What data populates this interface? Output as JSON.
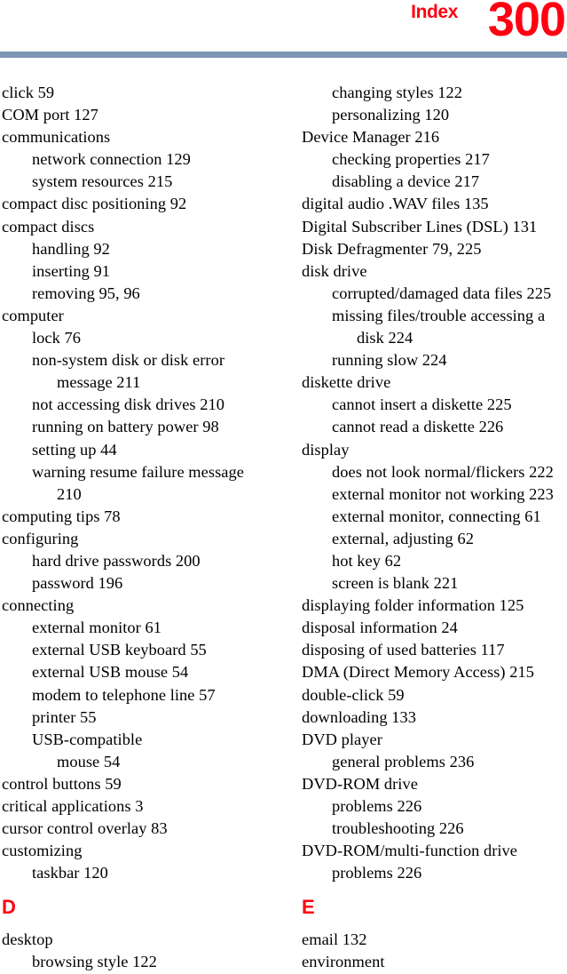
{
  "header": {
    "section_label": "Index",
    "page_number": "300",
    "label_color": "#ff0012",
    "rule_color": "#7e96b4"
  },
  "columns": [
    {
      "name": "left-column",
      "blocks": [
        {
          "type": "entries",
          "entries": [
            {
              "text": "click 59",
              "level": 0
            },
            {
              "text": "COM port 127",
              "level": 0
            },
            {
              "text": "communications",
              "level": 0
            },
            {
              "text": "network connection 129",
              "level": 1
            },
            {
              "text": "system resources 215",
              "level": 1
            },
            {
              "text": "compact disc positioning 92",
              "level": 0
            },
            {
              "text": "compact discs",
              "level": 0
            },
            {
              "text": "handling 92",
              "level": 1
            },
            {
              "text": "inserting 91",
              "level": 1
            },
            {
              "text": "removing 95, 96",
              "level": 1
            },
            {
              "text": "computer",
              "level": 0
            },
            {
              "text": "lock 76",
              "level": 1
            },
            {
              "text": "non-system disk or disk error",
              "level": 1
            },
            {
              "text": "message 211",
              "level": 2
            },
            {
              "text": "not accessing disk drives 210",
              "level": 1
            },
            {
              "text": "running on battery power 98",
              "level": 1
            },
            {
              "text": "setting up 44",
              "level": 1
            },
            {
              "text": "warning resume failure message",
              "level": 1
            },
            {
              "text": "210",
              "level": 2
            },
            {
              "text": "computing tips 78",
              "level": 0
            },
            {
              "text": "configuring",
              "level": 0
            },
            {
              "text": "hard drive passwords 200",
              "level": 1
            },
            {
              "text": "password 196",
              "level": 1
            },
            {
              "text": "connecting",
              "level": 0
            },
            {
              "text": "external monitor 61",
              "level": 1
            },
            {
              "text": "external USB keyboard 55",
              "level": 1
            },
            {
              "text": "external USB mouse 54",
              "level": 1
            },
            {
              "text": "modem to telephone line 57",
              "level": 1
            },
            {
              "text": "printer 55",
              "level": 1
            },
            {
              "text": "USB-compatible",
              "level": 1
            },
            {
              "text": "mouse 54",
              "level": 2
            },
            {
              "text": "control buttons 59",
              "level": 0
            },
            {
              "text": "critical applications 3",
              "level": 0
            },
            {
              "text": "cursor control overlay 83",
              "level": 0
            },
            {
              "text": "customizing",
              "level": 0
            },
            {
              "text": "taskbar 120",
              "level": 1
            }
          ]
        },
        {
          "type": "letter",
          "letter": "D"
        },
        {
          "type": "entries",
          "entries": [
            {
              "text": "desktop",
              "level": 0
            },
            {
              "text": "browsing style 122",
              "level": 1
            }
          ]
        }
      ]
    },
    {
      "name": "right-column",
      "blocks": [
        {
          "type": "entries",
          "entries": [
            {
              "text": "changing styles 122",
              "level": 1
            },
            {
              "text": "personalizing 120",
              "level": 1
            },
            {
              "text": "Device Manager 216",
              "level": 0
            },
            {
              "text": "checking properties 217",
              "level": 1
            },
            {
              "text": "disabling a device 217",
              "level": 1
            },
            {
              "text": "digital audio .WAV files 135",
              "level": 0
            },
            {
              "text": "Digital Subscriber Lines (DSL) 131",
              "level": 0
            },
            {
              "text": "Disk Defragmenter 79, 225",
              "level": 0
            },
            {
              "text": "disk drive",
              "level": 0
            },
            {
              "text": "corrupted/damaged data files 225",
              "level": 1
            },
            {
              "text": "missing files/trouble accessing a",
              "level": 1
            },
            {
              "text": "disk 224",
              "level": 2
            },
            {
              "text": "running slow 224",
              "level": 1
            },
            {
              "text": "diskette drive",
              "level": 0
            },
            {
              "text": "cannot insert a diskette 225",
              "level": 1
            },
            {
              "text": "cannot read a diskette 226",
              "level": 1
            },
            {
              "text": "display",
              "level": 0
            },
            {
              "text": "does not look normal/flickers 222",
              "level": 1
            },
            {
              "text": "external monitor not working 223",
              "level": 1
            },
            {
              "text": "external monitor, connecting 61",
              "level": 1
            },
            {
              "text": "external, adjusting 62",
              "level": 1
            },
            {
              "text": "hot key 62",
              "level": 1
            },
            {
              "text": "screen is blank 221",
              "level": 1
            },
            {
              "text": "displaying folder information 125",
              "level": 0
            },
            {
              "text": "disposal information 24",
              "level": 0
            },
            {
              "text": "disposing of used batteries 117",
              "level": 0
            },
            {
              "text": "DMA (Direct Memory Access) 215",
              "level": 0
            },
            {
              "text": "double-click 59",
              "level": 0
            },
            {
              "text": "downloading 133",
              "level": 0
            },
            {
              "text": "DVD player",
              "level": 0
            },
            {
              "text": "general problems 236",
              "level": 1
            },
            {
              "text": "DVD-ROM drive",
              "level": 0
            },
            {
              "text": "problems 226",
              "level": 1
            },
            {
              "text": "troubleshooting 226",
              "level": 1
            },
            {
              "text": "DVD-ROM/multi-function drive",
              "level": 0
            },
            {
              "text": "problems 226",
              "level": 1
            }
          ]
        },
        {
          "type": "letter",
          "letter": "E"
        },
        {
          "type": "entries",
          "entries": [
            {
              "text": "email 132",
              "level": 0
            },
            {
              "text": "environment",
              "level": 0
            }
          ]
        }
      ]
    }
  ]
}
